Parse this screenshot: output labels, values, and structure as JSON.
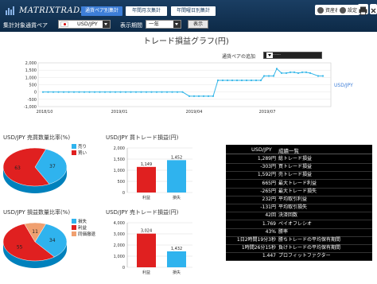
{
  "app": {
    "logo_text": "MATRIXTRADER"
  },
  "header": {
    "tabs": [
      {
        "label": "通貨ペア別集計",
        "active": true
      },
      {
        "label": "年間月次集計",
        "active": false
      },
      {
        "label": "年間曜日別集計",
        "active": false
      }
    ],
    "right_buttons": [
      {
        "label": "資産表"
      },
      {
        "label": "設定"
      }
    ],
    "icons": [
      "print-icon",
      "close-icon"
    ],
    "pair_label": "集計対象通貨ペア",
    "pair_value": "USD/JPY",
    "period_label": "表示期間",
    "period_value": "一年",
    "show_button": "表示"
  },
  "line_chart": {
    "title": "トレード損益グラフ(円)",
    "pair_add_label": "通貨ペアの追加",
    "pair_add_value": "----------",
    "series_label": "USD/JPY",
    "color": "#33b6e8",
    "y_ticks": [
      "2,000",
      "1,500",
      "1,000",
      "500",
      "0",
      "-500",
      "-1,000"
    ],
    "x_ticks": [
      "2018/10",
      "2019/01",
      "2019/04",
      "2019/07"
    ]
  },
  "pie1": {
    "title": "USD/JPY 売買数量比率(%)",
    "values": [
      37,
      63
    ],
    "labels": [
      "売り",
      "買い"
    ],
    "colors": [
      "#2fb3ee",
      "#e02020"
    ],
    "value_labels": [
      "37",
      "63"
    ]
  },
  "pie2": {
    "title": "USD/JPY 損益数量比率(%)",
    "values": [
      34,
      55,
      11
    ],
    "labels": [
      "損失",
      "利益",
      "同価撤退"
    ],
    "colors": [
      "#2fb3ee",
      "#e02020",
      "#f0a070"
    ],
    "value_labels": [
      "34",
      "55",
      "11"
    ]
  },
  "bar1": {
    "title": "USD/JPY 買トレード損益(円)",
    "y_ticks": [
      "2,000",
      "1,500",
      "1,000",
      "500",
      "0"
    ],
    "ymax": 2000,
    "categories": [
      "利益",
      "損失"
    ],
    "values": [
      1149,
      1452
    ],
    "value_labels": [
      "1,149",
      "1,452"
    ],
    "colors": [
      "#e02020",
      "#2fb3ee"
    ]
  },
  "bar2": {
    "title": "USD/JPY 売トレード損益(円)",
    "y_ticks": [
      "4,000",
      "3,000",
      "2,000",
      "1,000",
      "0"
    ],
    "ymax": 4000,
    "categories": [
      "利益",
      "損失"
    ],
    "values": [
      3024,
      1432
    ],
    "value_labels": [
      "3,024",
      "1,432"
    ],
    "colors": [
      "#e02020",
      "#2fb3ee"
    ]
  },
  "summary": {
    "header_pair": "USD/JPY",
    "header_title": "成績一覧",
    "rows": [
      {
        "value": "1,289円",
        "label": "総トレード損益"
      },
      {
        "value": "-303円",
        "label": "買トレード損益"
      },
      {
        "value": "1,592円",
        "label": "売トレード損益"
      },
      {
        "value": "665円",
        "label": "最大トレード利益"
      },
      {
        "value": "-265円",
        "label": "最大トレード損失"
      },
      {
        "value": "232円",
        "label": "平均取引利益"
      },
      {
        "value": "-131円",
        "label": "平均取引損失"
      },
      {
        "value": "42回",
        "label": "決済回数"
      },
      {
        "value": "1.769",
        "label": "ペイオフレシオ"
      },
      {
        "value": "43%",
        "label": "勝率"
      },
      {
        "value": "1日2時間19分3秒",
        "label": "勝ちトレードの平均保有期間"
      },
      {
        "value": "1時間26分15秒",
        "label": "負けトレードの平均保有期間"
      },
      {
        "value": "1.447",
        "label": "プロフィットファクター"
      }
    ]
  }
}
